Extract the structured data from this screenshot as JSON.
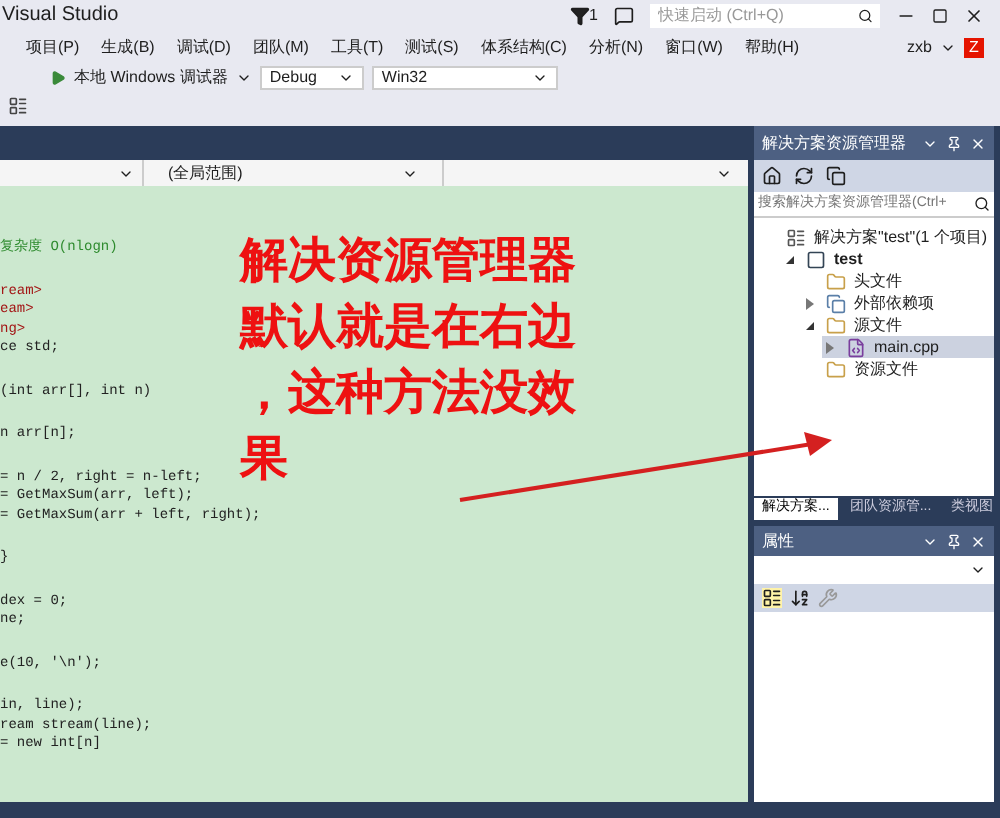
{
  "window": {
    "title": "Visual Studio",
    "notification_count": "1",
    "quick_launch": {
      "placeholder": "快速启动 (Ctrl+Q)"
    },
    "user": "zxb",
    "avatar_letter": "Z"
  },
  "menu": [
    "项目(P)",
    "生成(B)",
    "调试(D)",
    "团队(M)",
    "工具(T)",
    "测试(S)",
    "体系结构(C)",
    "分析(N)",
    "窗口(W)",
    "帮助(H)"
  ],
  "toolbar": {
    "debugger": "本地 Windows 调试器",
    "configuration": "Debug",
    "platform": "Win32"
  },
  "editor": {
    "scope": "(全局范围)",
    "code_blocks": [
      {
        "lines": [
          {
            "kind": "comment",
            "text": "复杂度 O(nlogn)"
          }
        ]
      },
      {
        "lines": [
          {
            "kind": "include",
            "text": "ream>"
          },
          {
            "kind": "include",
            "text": "eam>"
          },
          {
            "kind": "include",
            "text": "ng>"
          },
          {
            "kind": "code",
            "text": "ce std;"
          }
        ]
      },
      {
        "lines": [
          {
            "kind": "code",
            "text": "(int arr[], int n)"
          }
        ]
      },
      {
        "lines": [
          {
            "kind": "code",
            "text": "n arr[n];"
          }
        ]
      },
      {
        "lines": [
          {
            "kind": "code",
            "text": "= n / 2, right = n-left;"
          },
          {
            "kind": "code",
            "text": "= GetMaxSum(arr, left);"
          },
          {
            "kind": "code",
            "text": "= GetMaxSum(arr + left, right);"
          }
        ]
      },
      {
        "lines": [
          {
            "kind": "code",
            "text": "}"
          }
        ]
      },
      {
        "lines": [
          {
            "kind": "code",
            "text": "dex = 0;"
          },
          {
            "kind": "code",
            "text": "ne;"
          }
        ]
      },
      {
        "lines": [
          {
            "kind": "code",
            "text": "e(10, '\\n');"
          }
        ]
      },
      {
        "lines": [
          {
            "kind": "code",
            "text": "in, line);"
          },
          {
            "kind": "code",
            "text": "ream stream(line);"
          },
          {
            "kind": "code",
            "text": "= new int[n]"
          }
        ]
      }
    ]
  },
  "annotation": {
    "lines": [
      "解决资源管理器",
      "默认就是在右边",
      "，这种方法没效",
      "果"
    ]
  },
  "solution_explorer": {
    "title": "解决方案资源管理器",
    "search": {
      "placeholder": "搜索解决方案资源管理器(Ctrl+"
    },
    "tree": [
      {
        "label": "解决方案\"test\"(1 个项目)",
        "kind": "solution",
        "children": [
          {
            "label": "test",
            "kind": "project",
            "expanded": true,
            "selected": false,
            "children": [
              {
                "label": "头文件",
                "kind": "folder",
                "selected": false
              },
              {
                "label": "外部依赖项",
                "kind": "deps",
                "expanded": false,
                "selected": false
              },
              {
                "label": "源文件",
                "kind": "folder",
                "expanded": true,
                "selected": false,
                "children": [
                  {
                    "label": "main.cpp",
                    "kind": "file",
                    "expanded": false,
                    "selected": true
                  }
                ]
              },
              {
                "label": "资源文件",
                "kind": "folder",
                "selected": false
              }
            ]
          }
        ]
      }
    ],
    "tabs": [
      {
        "label": "解决方案...",
        "selected": true
      },
      {
        "label": "团队资源管...",
        "selected": false
      },
      {
        "label": "类视图",
        "selected": false
      }
    ]
  },
  "properties": {
    "title": "属性"
  }
}
